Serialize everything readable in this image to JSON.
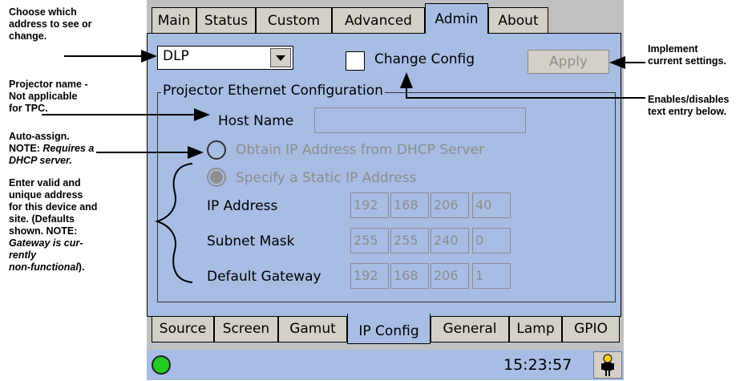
{
  "tabs_top": [
    {
      "label": "Main"
    },
    {
      "label": "Status"
    },
    {
      "label": "Custom"
    },
    {
      "label": "Advanced"
    },
    {
      "label": "Admin"
    },
    {
      "label": "About"
    }
  ],
  "tabs_bottom": [
    {
      "label": "Source"
    },
    {
      "label": "Screen"
    },
    {
      "label": "Gamut"
    },
    {
      "label": "IP Config"
    },
    {
      "label": "General"
    },
    {
      "label": "Lamp"
    },
    {
      "label": "GPIO"
    }
  ],
  "device_select": {
    "value": "DLP"
  },
  "change_config": {
    "label": "Change Config",
    "checked": false
  },
  "apply_button": {
    "label": "Apply",
    "enabled": false
  },
  "group_title": "Projector Ethernet Configuration",
  "host_name": {
    "label": "Host Name",
    "value": ""
  },
  "radio_dhcp": {
    "label": "Obtain IP Address from DHCP Server",
    "selected": false
  },
  "radio_static": {
    "label": "Specify a Static IP Address",
    "selected": true
  },
  "ip_address": {
    "label": "IP Address",
    "octets": [
      "192",
      "168",
      "206",
      "40"
    ]
  },
  "subnet_mask": {
    "label": "Subnet Mask",
    "octets": [
      "255",
      "255",
      "240",
      "0"
    ]
  },
  "default_gateway": {
    "label": "Default Gateway",
    "octets": [
      "192",
      "168",
      "206",
      "1"
    ]
  },
  "status": {
    "time": "15:23:57",
    "indicator_color": "#22cc22"
  },
  "colors": {
    "panel": "#a7bde4",
    "tab": "#d4d0c8",
    "disabled_text": "#8e8e8e"
  },
  "annotations": {
    "choose_address": [
      "Choose which",
      "address to see or",
      "change."
    ],
    "projector_name": [
      "Projector name -",
      "Not applicable",
      "for TPC."
    ],
    "auto_assign_1": "Auto-assign.",
    "auto_assign_note": "NOTE: ",
    "auto_assign_italic_1": "Requires a",
    "auto_assign_italic_2": "DHCP server.",
    "enter_valid": [
      "Enter valid and",
      "unique address",
      "for this device and",
      "site. (Defaults",
      "shown. NOTE:"
    ],
    "enter_valid_italic": [
      "Gateway is cur-",
      "rently",
      "non-functional"
    ],
    "enter_valid_end": ").",
    "implement": [
      "Implement",
      "current settings."
    ],
    "enables": [
      "Enables/disables",
      "text entry below."
    ]
  }
}
